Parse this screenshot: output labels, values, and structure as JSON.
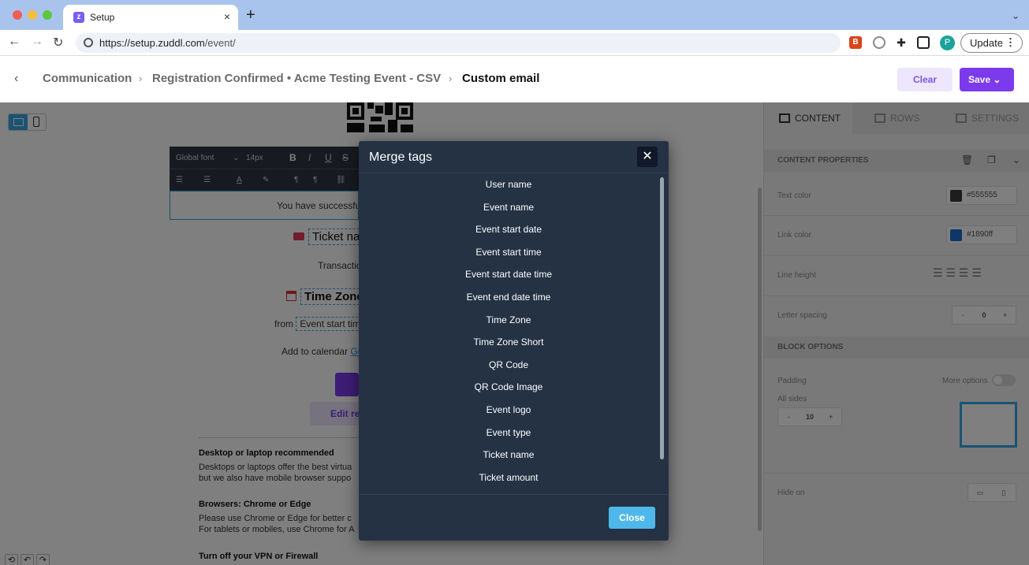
{
  "browser": {
    "tab_title": "Setup",
    "tab_close": "×",
    "new_tab": "+",
    "tab_list": "⌄",
    "url_host": "https://setup.zuddl.com",
    "url_path": "/event/",
    "update_label": "Update",
    "profile_initial": "P",
    "favicon_letter": "z"
  },
  "header": {
    "back": "‹",
    "breadcrumbs": [
      "Communication",
      "Registration Confirmed • Acme Testing Event - CSV",
      "Custom email"
    ],
    "separator": "›",
    "clear_label": "Clear",
    "save_label": "Save ⌄"
  },
  "editor": {
    "rte": {
      "font": "Global font",
      "size": "14px"
    },
    "text_block": "You have successful",
    "ticket": "Ticket na",
    "transaction": "Transactic",
    "timezone": "Time Zone",
    "from_prefix": "from",
    "from_tag": "Event start time",
    "add_calendar": "Add to calendar",
    "add_calendar_link": "Go",
    "edit_button": "Edit re",
    "sections": [
      {
        "title": "Desktop or laptop recommended",
        "lines": [
          "Desktops or laptops offer the best virtua",
          "but we also have mobile browser suppo"
        ]
      },
      {
        "title": "Browsers: Chrome or Edge",
        "lines": [
          "Please use Chrome or Edge for better c",
          "For tablets or mobiles, use Chrome for A"
        ]
      },
      {
        "title": "Turn off your VPN or Firewall",
        "lines": []
      }
    ]
  },
  "panel": {
    "tabs": [
      "CONTENT",
      "ROWS",
      "SETTINGS"
    ],
    "content_properties": "CONTENT PROPERTIES",
    "text_color_label": "Text color",
    "text_color": "#555555",
    "link_color_label": "Link color",
    "link_color": "#1890ff",
    "line_height_label": "Line height",
    "letter_spacing_label": "Letter spacing",
    "letter_spacing_value": "0",
    "block_options": "BLOCK OPTIONS",
    "padding_label": "Padding",
    "more_options_label": "More options",
    "all_sides_label": "All sides",
    "padding_value": "10",
    "hide_on_label": "Hide on",
    "minus": "-",
    "plus": "+"
  },
  "modal": {
    "title": "Merge tags",
    "close_x": "✕",
    "close_button": "Close",
    "tags": [
      "User name",
      "Event name",
      "Event start date",
      "Event start time",
      "Event start date time",
      "Event end date time",
      "Time Zone",
      "Time Zone Short",
      "QR Code",
      "QR Code Image",
      "Event logo",
      "Event type",
      "Ticket name",
      "Ticket amount"
    ]
  },
  "colors": {
    "accent": "#7c3aed",
    "modal_bg": "#243244",
    "close_btn": "#4fb8ea",
    "link": "#1890ff"
  }
}
